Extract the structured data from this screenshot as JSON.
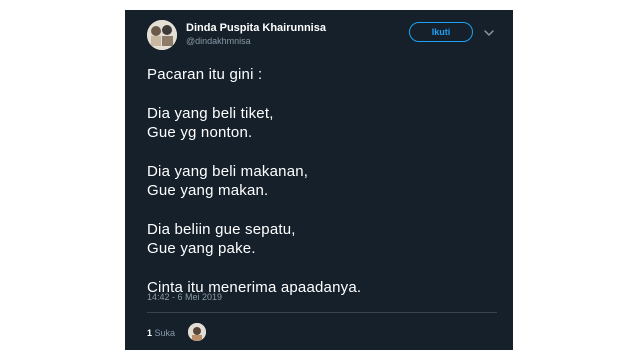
{
  "tweet": {
    "author": {
      "name": "Dinda Puspita Khairunnisa",
      "handle": "@dindakhmnisa"
    },
    "follow_label": "Ikuti",
    "lines": [
      "Pacaran itu gini :",
      "",
      "Dia yang beli tiket,",
      "Gue yg nonton.",
      "",
      "Dia yang beli makanan,",
      "Gue yang makan.",
      "",
      "Dia beliin gue sepatu,",
      "Gue yang pake.",
      "",
      "Cinta itu menerima apaadanya."
    ],
    "timestamp": "14:42 - 6 Mei 2019",
    "likes": {
      "count": "1",
      "label": "Suka"
    }
  },
  "colors": {
    "background": "#15202b",
    "accent": "#1da1f2",
    "muted": "#8899a6"
  },
  "icons": {
    "menu": "chevron-down-icon"
  }
}
